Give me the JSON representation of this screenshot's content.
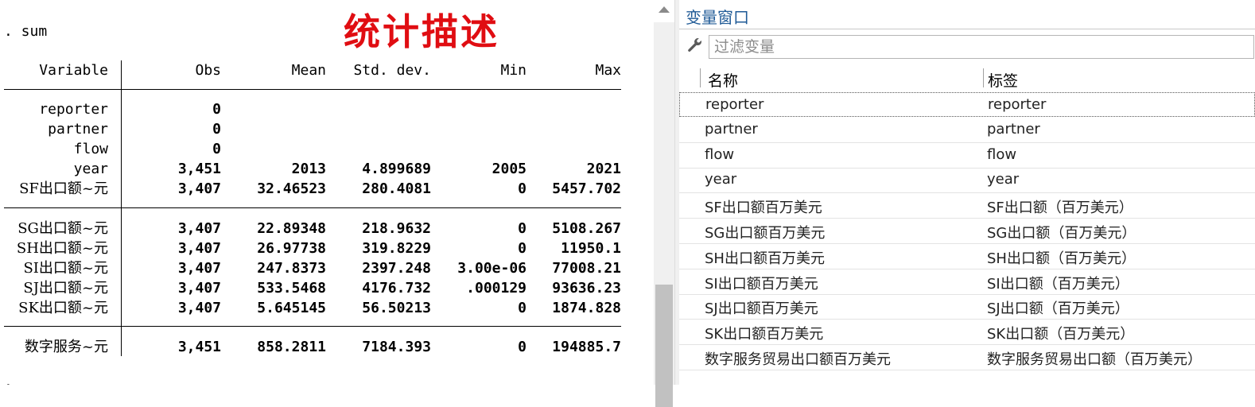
{
  "results": {
    "command": ". sum",
    "next_prompt": ".",
    "annotation": "统计描述",
    "headers": {
      "variable": "Variable",
      "obs": "Obs",
      "mean": "Mean",
      "sd": "Std. dev.",
      "min": "Min",
      "max": "Max"
    },
    "rows": [
      {
        "variable": "reporter",
        "obs": "0",
        "mean": "",
        "sd": "",
        "min": "",
        "max": ""
      },
      {
        "variable": "partner",
        "obs": "0",
        "mean": "",
        "sd": "",
        "min": "",
        "max": ""
      },
      {
        "variable": "flow",
        "obs": "0",
        "mean": "",
        "sd": "",
        "min": "",
        "max": ""
      },
      {
        "variable": "year",
        "obs": "3,451",
        "mean": "2013",
        "sd": "4.899689",
        "min": "2005",
        "max": "2021"
      },
      {
        "variable": "SF出口额~元",
        "obs": "3,407",
        "mean": "32.46523",
        "sd": "280.4081",
        "min": "0",
        "max": "5457.702"
      },
      {
        "variable": "SG出口额~元",
        "obs": "3,407",
        "mean": "22.89348",
        "sd": "218.9632",
        "min": "0",
        "max": "5108.267"
      },
      {
        "variable": "SH出口额~元",
        "obs": "3,407",
        "mean": "26.97738",
        "sd": "319.8229",
        "min": "0",
        "max": "11950.1"
      },
      {
        "variable": "SI出口额~元",
        "obs": "3,407",
        "mean": "247.8373",
        "sd": "2397.248",
        "min": "3.00e-06",
        "max": "77008.21"
      },
      {
        "variable": "SJ出口额~元",
        "obs": "3,407",
        "mean": "533.5468",
        "sd": "4176.732",
        "min": ".000129",
        "max": "93636.23"
      },
      {
        "variable": "SK出口额~元",
        "obs": "3,407",
        "mean": "5.645145",
        "sd": "56.50213",
        "min": "0",
        "max": "1874.828"
      },
      {
        "variable": "数字服务~元",
        "obs": "3,451",
        "mean": "858.2811",
        "sd": "7184.393",
        "min": "0",
        "max": "194885.7"
      }
    ]
  },
  "variables_window": {
    "title": "变量窗口",
    "filter_placeholder": "过滤变量",
    "col_name": "名称",
    "col_label": "标签",
    "rows": [
      {
        "name": "reporter",
        "label": "reporter"
      },
      {
        "name": "partner",
        "label": "partner"
      },
      {
        "name": "flow",
        "label": "flow"
      },
      {
        "name": "year",
        "label": "year"
      },
      {
        "name": "SF出口额百万美元",
        "label": "SF出口额（百万美元）"
      },
      {
        "name": "SG出口额百万美元",
        "label": "SG出口额（百万美元）"
      },
      {
        "name": "SH出口额百万美元",
        "label": "SH出口额（百万美元）"
      },
      {
        "name": "SI出口额百万美元",
        "label": "SI出口额（百万美元）"
      },
      {
        "name": "SJ出口额百万美元",
        "label": "SJ出口额（百万美元）"
      },
      {
        "name": "SK出口额百万美元",
        "label": "SK出口额（百万美元）"
      },
      {
        "name": "数字服务贸易出口额百万美元",
        "label": "数字服务贸易出口额（百万美元）"
      }
    ]
  }
}
